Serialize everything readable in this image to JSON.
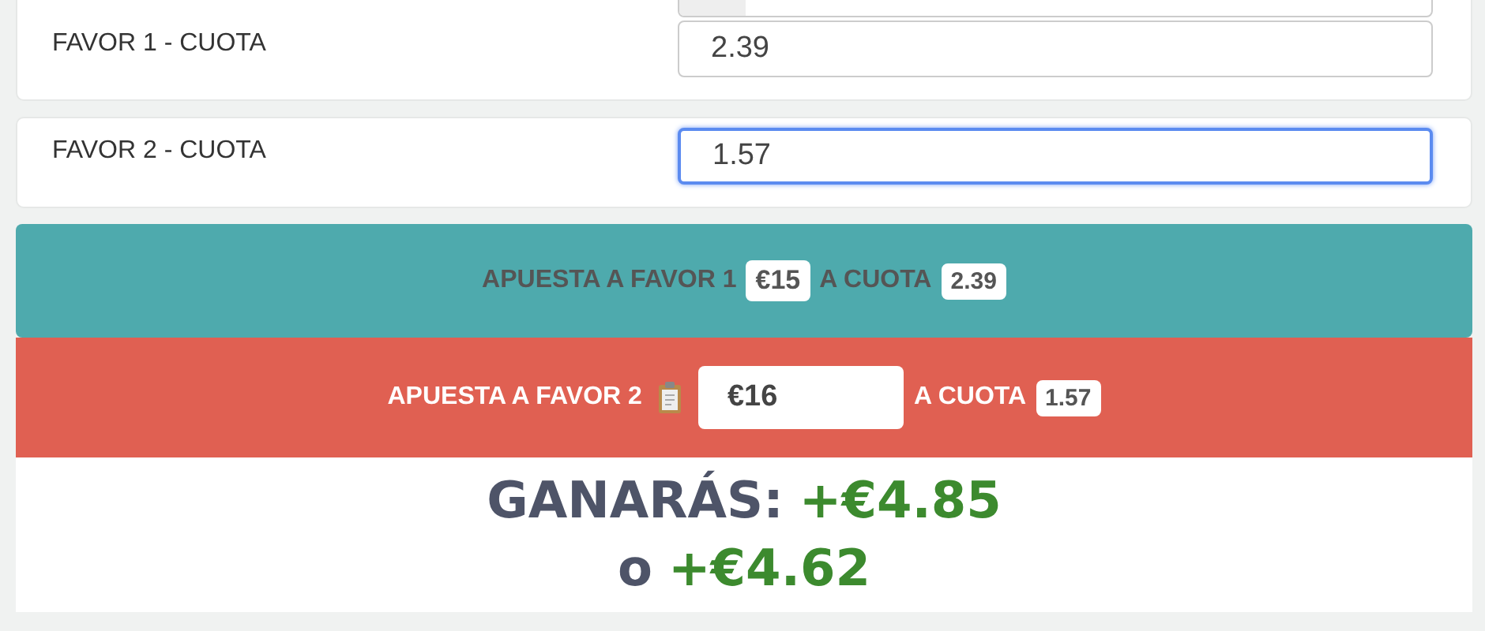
{
  "fields": [
    {
      "label": "FAVOR 1 - CUOTA",
      "value": "2.39",
      "focused": false
    },
    {
      "label": "FAVOR 2 - CUOTA",
      "value": "1.57",
      "focused": true
    }
  ],
  "bets": [
    {
      "kind": "badge",
      "label": "APUESTA A FAVOR 1",
      "amount": "€15",
      "odds_label": "A CUOTA",
      "odds": "2.39",
      "color": "#4eaaad"
    },
    {
      "kind": "input",
      "label": "APUESTA A FAVOR 2",
      "amount": "€16",
      "odds_label": "A CUOTA",
      "odds": "1.57",
      "color": "#e06052"
    }
  ],
  "result": {
    "label": "GANARÁS:",
    "first": "+€4.85",
    "joiner": "o",
    "second": "+€4.62"
  }
}
